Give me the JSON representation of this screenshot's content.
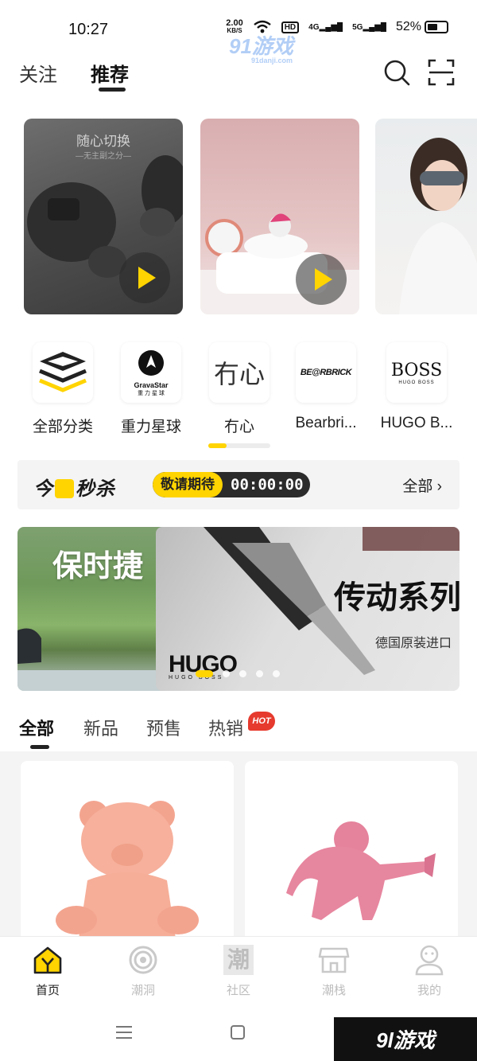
{
  "status_bar": {
    "time": "10:27",
    "network_speed": "2.00",
    "network_speed_unit": "KB/S",
    "hd_label": "HD",
    "signal_1": "4G",
    "signal_2": "5G",
    "battery_percent": "52%"
  },
  "watermark": {
    "top_text": "91游戏",
    "top_sub": "91danji.com",
    "bottom_text": "9l游戏"
  },
  "header": {
    "tabs": [
      {
        "label": "关注",
        "active": false
      },
      {
        "label": "推荐",
        "active": true
      }
    ],
    "icons": [
      "search-icon",
      "scan-icon"
    ]
  },
  "videos": [
    {
      "title": "随心切换",
      "subtitle": "—无主副之分—",
      "has_play": true
    },
    {
      "title": "",
      "subtitle": "",
      "has_play": true
    },
    {
      "title": "",
      "subtitle": "",
      "has_play": false
    }
  ],
  "brands": {
    "items": [
      {
        "label": "全部分类",
        "logo_icon": "all-categories-icon"
      },
      {
        "label": "重力星球",
        "logo_text": "GravaStar",
        "logo_sub": "重 力 星 球"
      },
      {
        "label": "冇心",
        "logo_text": "冇心"
      },
      {
        "label": "Bearbri...",
        "logo_text": "BE@RBRICK"
      },
      {
        "label": "HUGO B...",
        "logo_text": "BOSS",
        "logo_sub": "HUGO BOSS"
      }
    ],
    "scroll_progress": 0.3
  },
  "flash_sale": {
    "title_prefix": "今",
    "title_suffix": "秒杀",
    "status": "敬请期待",
    "countdown": "00:00:00",
    "all_label": "全部"
  },
  "banners": {
    "items": [
      {
        "title": "保时捷"
      },
      {
        "title": "传动系列",
        "subtitle": "德国原装进口",
        "brand": "HUGO",
        "brand_sub": "HUGO BOSS"
      }
    ],
    "dot_count": 5,
    "active_dot": 0
  },
  "category_tabs": {
    "items": [
      {
        "label": "全部",
        "active": true
      },
      {
        "label": "新品",
        "active": false
      },
      {
        "label": "预售",
        "active": false
      },
      {
        "label": "热销",
        "active": false
      }
    ],
    "hot_badge": "HOT"
  },
  "products": [
    {
      "name": "",
      "image_icon": "pink-bear-figure-icon"
    },
    {
      "name": "",
      "image_icon": "pink-gorilla-figure-icon"
    }
  ],
  "bottom_nav": {
    "items": [
      {
        "label": "首页",
        "icon": "home-icon",
        "active": true
      },
      {
        "label": "潮洞",
        "icon": "cave-icon",
        "active": false
      },
      {
        "label": "社区",
        "icon": "community-icon",
        "active": false
      },
      {
        "label": "潮栈",
        "icon": "shop-icon",
        "active": false
      },
      {
        "label": "我的",
        "icon": "profile-icon",
        "active": false
      }
    ]
  },
  "colors": {
    "accent": "#ffd400",
    "hot": "#e63a2e",
    "text": "#222222",
    "inactive": "#bdbdbd"
  }
}
